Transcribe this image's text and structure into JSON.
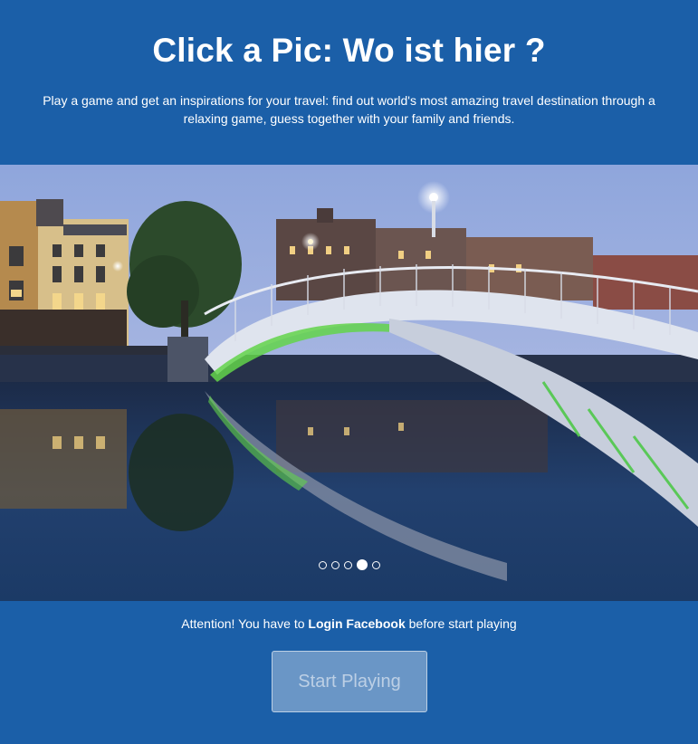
{
  "header": {
    "title": "Click a Pic: Wo ist hier ?",
    "subtitle": "Play a game and get an inspirations for your travel: find out world's most amazing travel destination through a relaxing game, guess together with your family and friends."
  },
  "slider": {
    "image_subject": "Arched pedestrian bridge over a river at dusk with reflections",
    "slide_count": 5,
    "active_slide": 4
  },
  "notice": {
    "prefix": "Attention! You have to ",
    "emphasis": "Login Facebook",
    "suffix": " before start playing"
  },
  "actions": {
    "start_label": "Start Playing"
  },
  "colors": {
    "background": "#1b5fa8",
    "button_bg": "rgba(255,255,255,0.35)",
    "button_text": "rgba(255,255,255,0.55)"
  }
}
